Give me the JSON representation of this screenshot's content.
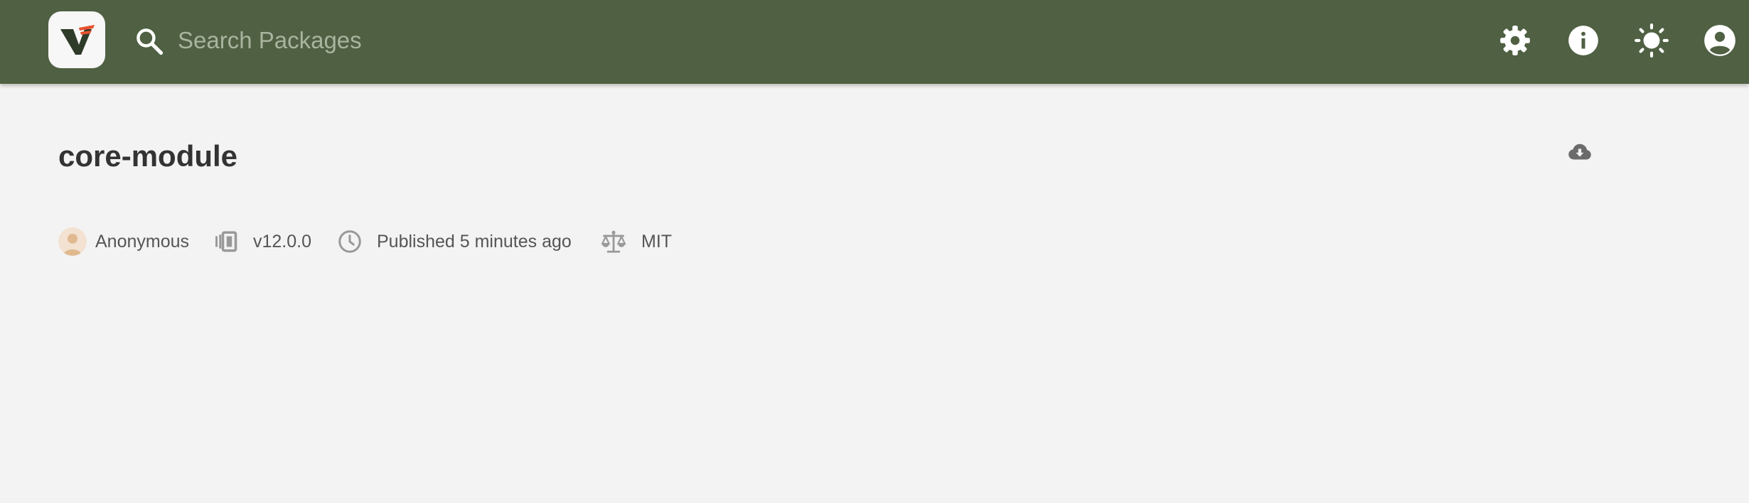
{
  "header": {
    "search_placeholder": "Search Packages",
    "brand_color": "#4f6043",
    "icons": [
      "settings-icon",
      "info-icon",
      "theme-toggle-icon",
      "account-icon"
    ]
  },
  "package": {
    "name": "core-module",
    "author": "Anonymous",
    "version": "v12.0.0",
    "published": "Published 5 minutes ago",
    "license": "MIT"
  }
}
